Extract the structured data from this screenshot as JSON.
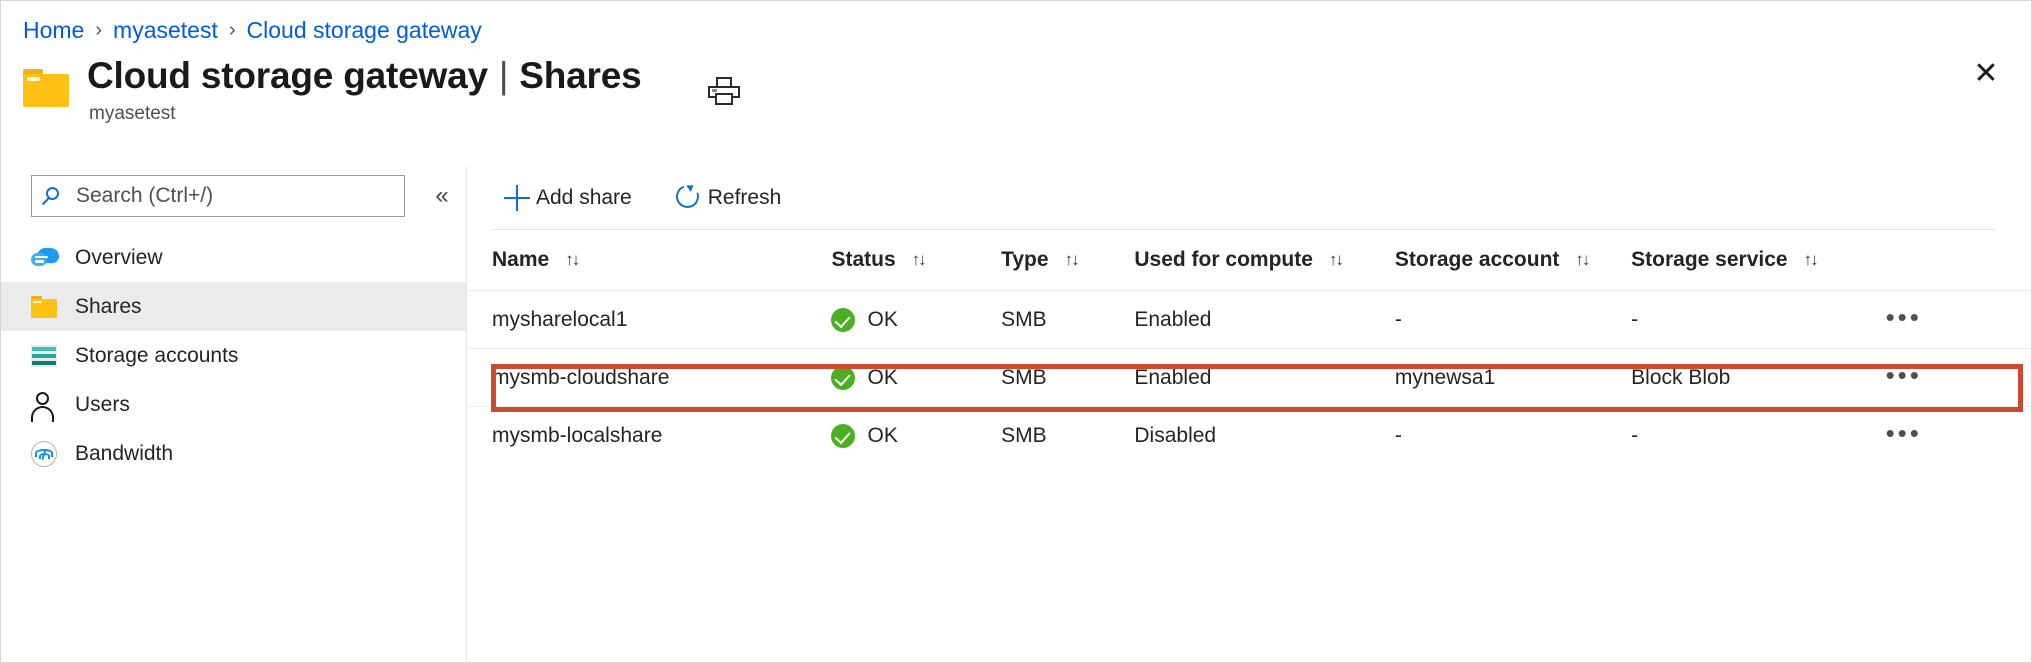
{
  "breadcrumb": {
    "items": [
      {
        "label": "Home"
      },
      {
        "label": "myasetest"
      },
      {
        "label": "Cloud storage gateway"
      }
    ],
    "separator": "›"
  },
  "header": {
    "title": "Cloud storage gateway",
    "title_separator": "|",
    "section": "Shares",
    "subtitle": "myasetest",
    "print_icon": "printer-icon",
    "close_icon": "✕"
  },
  "sidebar": {
    "search": {
      "placeholder": "Search (Ctrl+/)",
      "value": "",
      "icon": "search-icon"
    },
    "collapse_icon": "«",
    "items": [
      {
        "label": "Overview",
        "icon": "cloud-icon",
        "selected": false
      },
      {
        "label": "Shares",
        "icon": "folder-icon",
        "selected": true
      },
      {
        "label": "Storage accounts",
        "icon": "storage-accounts-icon",
        "selected": false
      },
      {
        "label": "Users",
        "icon": "user-icon",
        "selected": false
      },
      {
        "label": "Bandwidth",
        "icon": "bandwidth-icon",
        "selected": false
      }
    ]
  },
  "toolbar": {
    "add_share_label": "Add share",
    "add_share_icon": "plus-icon",
    "refresh_label": "Refresh",
    "refresh_icon": "refresh-icon"
  },
  "table": {
    "sort_icon": "↑↓",
    "menu_icon": "•••",
    "columns": [
      {
        "key": "name",
        "label": "Name",
        "sortable": true
      },
      {
        "key": "status",
        "label": "Status",
        "sortable": true
      },
      {
        "key": "type",
        "label": "Type",
        "sortable": true
      },
      {
        "key": "used_for_compute",
        "label": "Used for compute",
        "sortable": true
      },
      {
        "key": "storage_account",
        "label": "Storage account",
        "sortable": true
      },
      {
        "key": "storage_service",
        "label": "Storage service",
        "sortable": true
      }
    ],
    "rows": [
      {
        "name": "mysharelocal1",
        "status": "OK",
        "type": "SMB",
        "used_for_compute": "Enabled",
        "storage_account": "-",
        "storage_service": "-",
        "highlighted": false
      },
      {
        "name": "mysmb-cloudshare",
        "status": "OK",
        "type": "SMB",
        "used_for_compute": "Enabled",
        "storage_account": "mynewsa1",
        "storage_service": "Block Blob",
        "highlighted": true
      },
      {
        "name": "mysmb-localshare",
        "status": "OK",
        "type": "SMB",
        "used_for_compute": "Disabled",
        "storage_account": "-",
        "storage_service": "-",
        "highlighted": false
      }
    ]
  },
  "colors": {
    "link": "#015cda",
    "accent": "#0f6fd6",
    "status_ok": "#4caf22",
    "highlight_border": "#cb4b32",
    "folder": "#ffc114",
    "selected_row_bg": "#ebebeb"
  }
}
